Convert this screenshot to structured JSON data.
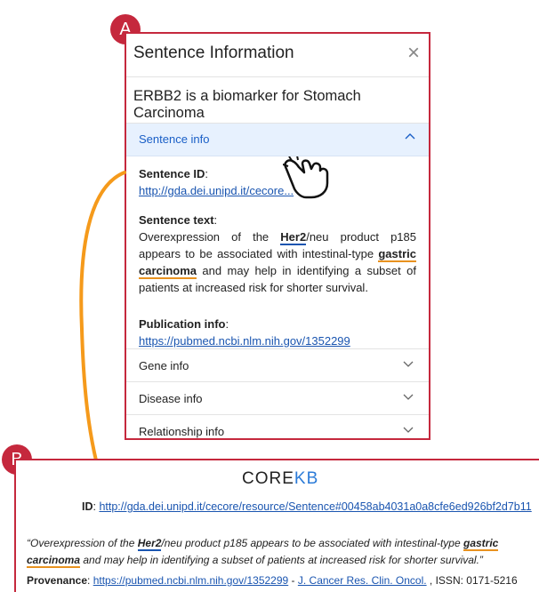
{
  "badges": {
    "a": "A",
    "b": "B"
  },
  "dialog": {
    "title": "Sentence Information",
    "close": "×",
    "subtitle": "ERBB2 is a biomarker for Stomach Carcinoma",
    "sections": {
      "sentence": {
        "label": "Sentence info",
        "id_label": "Sentence ID",
        "id_value": "http://gda.dei.unipd.it/cecore...",
        "text_label": "Sentence text",
        "text_pre": "Overexpression of the ",
        "text_her2": "Her2",
        "text_mid": "/neu product p185 appears to be associated with intestinal-type ",
        "text_gc": "gastric carcinoma",
        "text_post": " and may help in identifying a subset of patients at increased risk for shorter survival.",
        "pub_label": "Publication info",
        "pub_value": "https://pubmed.ncbi.nlm.nih.gov/1352299"
      },
      "gene": {
        "label": "Gene info"
      },
      "disease": {
        "label": "Disease info"
      },
      "relationship": {
        "label": "Relationship info"
      }
    }
  },
  "corekb": {
    "logo_core": "CORE",
    "logo_kb": "KB",
    "id_label": "ID",
    "id_value": "http://gda.dei.unipd.it/cecore/resource/Sentence#00458ab4031a0a8cfe6ed926bf2d7b11",
    "quote_pre": "“Overexpression of the ",
    "quote_her2": "Her2",
    "quote_mid": "/neu product p185 appears to be associated with intestinal-type ",
    "quote_gc": "gastric carcinoma",
    "quote_post": " and may help in identifying a subset of patients at increased risk for shorter survival.”",
    "prov_label": "Provenance",
    "prov_url": "https://pubmed.ncbi.nlm.nih.gov/1352299",
    "prov_sep": " - ",
    "prov_journal": "J. Cancer Res. Clin. Oncol.",
    "prov_issn": " , ISSN: 0171-5216"
  },
  "colors": {
    "accent_red": "#c5283d",
    "arrow_orange": "#f59a1b",
    "link_blue": "#1a55b0"
  },
  "icons": [
    "close-icon",
    "chevron-up-icon",
    "chevron-down-icon",
    "copy-icon",
    "pointing-hand-icon",
    "curved-arrow-icon"
  ]
}
